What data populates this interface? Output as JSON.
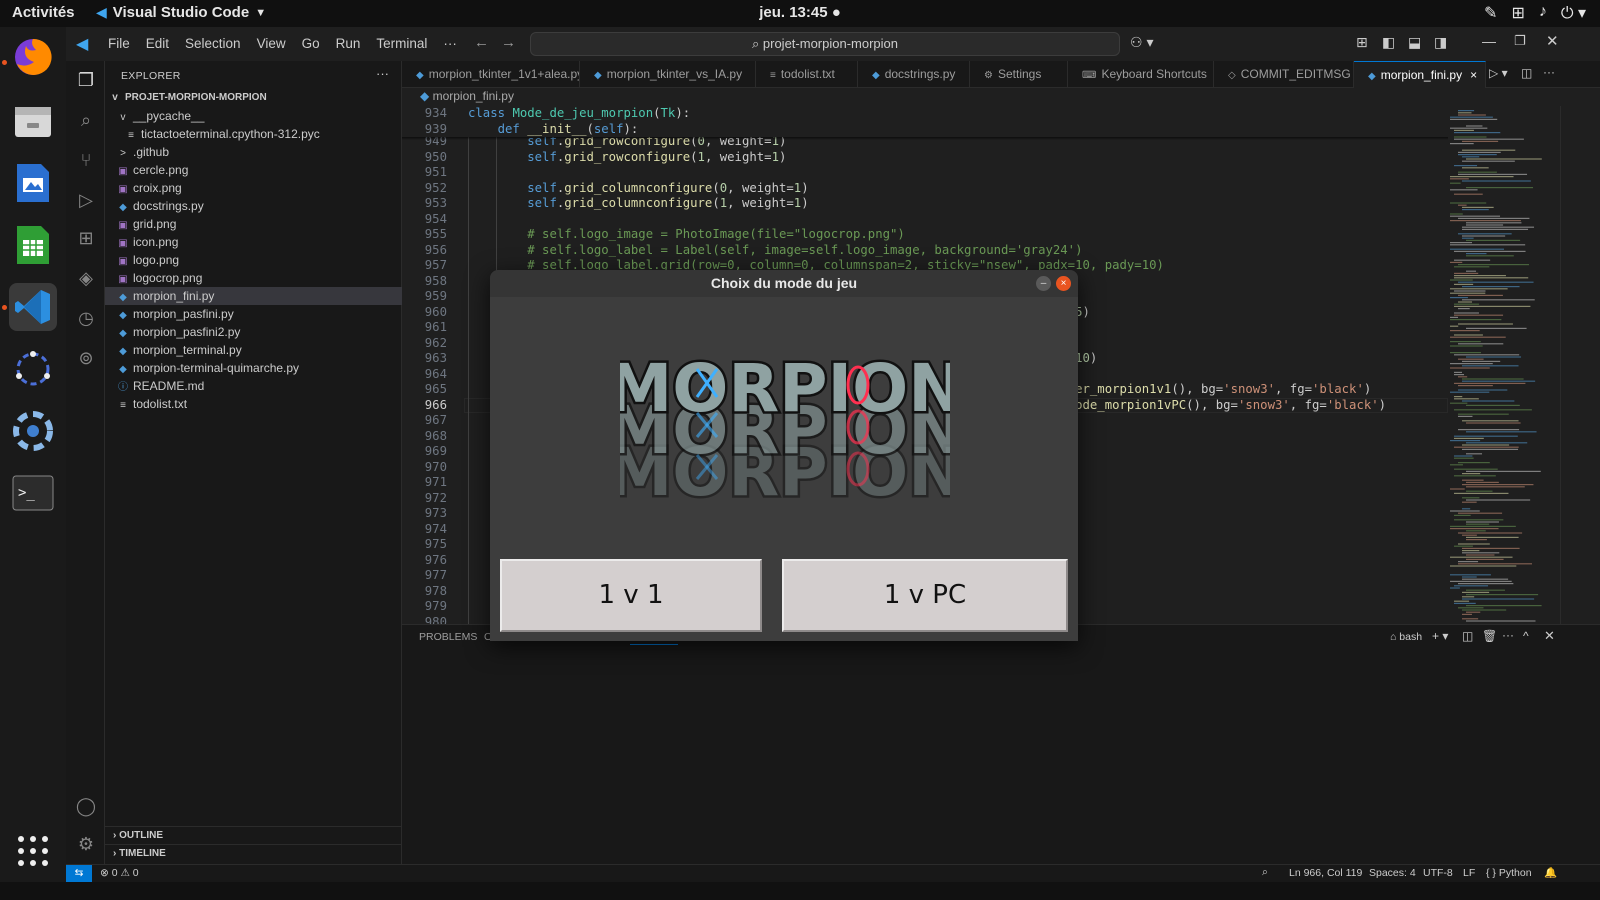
{
  "topbar": {
    "activities": "Activités",
    "app_name": "Visual Studio Code",
    "clock": "jeu. 13:45"
  },
  "dock": [
    "firefox-icon",
    "files-icon",
    "writer-icon",
    "calc-icon",
    "vscode-icon",
    "app-icon",
    "steam-icon",
    "terminal-icon",
    "show-apps-icon"
  ],
  "vscode": {
    "menu": [
      "File",
      "Edit",
      "Selection",
      "View",
      "Go",
      "Run",
      "Terminal",
      "···"
    ],
    "command_center": "projet-morpion-morpion",
    "explorer": {
      "title": "EXPLORER",
      "project": "PROJET-MORPION-MORPION",
      "items": [
        {
          "label": "__pycache__",
          "indent": 1,
          "icon": "v"
        },
        {
          "label": "tictactoeterminal.cpython-312.pyc",
          "indent": 2,
          "icon": "≡"
        },
        {
          "label": ".github",
          "indent": 1,
          "icon": ">"
        },
        {
          "label": "cercle.png",
          "indent": 1,
          "icon": "▣"
        },
        {
          "label": "croix.png",
          "indent": 1,
          "icon": "▣"
        },
        {
          "label": "docstrings.py",
          "indent": 1,
          "icon": "◆"
        },
        {
          "label": "grid.png",
          "indent": 1,
          "icon": "▣"
        },
        {
          "label": "icon.png",
          "indent": 1,
          "icon": "▣"
        },
        {
          "label": "logo.png",
          "indent": 1,
          "icon": "▣"
        },
        {
          "label": "logocrop.png",
          "indent": 1,
          "icon": "▣"
        },
        {
          "label": "morpion_fini.py",
          "indent": 1,
          "icon": "◆",
          "selected": true
        },
        {
          "label": "morpion_pasfini.py",
          "indent": 1,
          "icon": "◆"
        },
        {
          "label": "morpion_pasfini2.py",
          "indent": 1,
          "icon": "◆"
        },
        {
          "label": "morpion_terminal.py",
          "indent": 1,
          "icon": "◆"
        },
        {
          "label": "morpion-terminal-quimarche.py",
          "indent": 1,
          "icon": "◆"
        },
        {
          "label": "README.md",
          "indent": 1,
          "icon": "ⓘ"
        },
        {
          "label": "todolist.txt",
          "indent": 1,
          "icon": "≡"
        }
      ],
      "outline": "OUTLINE",
      "timeline": "TIMELINE"
    },
    "tabs": [
      {
        "label": "morpion_tkinter_1v1+alea.py",
        "icon": "◆"
      },
      {
        "label": "morpion_tkinter_vs_IA.py",
        "icon": "◆"
      },
      {
        "label": "todolist.txt",
        "icon": "≡"
      },
      {
        "label": "docstrings.py",
        "icon": "◆"
      },
      {
        "label": "Settings",
        "icon": "⚙"
      },
      {
        "label": "Keyboard Shortcuts",
        "icon": "⌨"
      },
      {
        "label": "COMMIT_EDITMSG",
        "icon": "◇"
      },
      {
        "label": "morpion_fini.py",
        "icon": "◆",
        "active": true,
        "close": "×"
      }
    ],
    "breadcrumb": "morpion_fini.py",
    "sticky": [
      {
        "n": "934",
        "html": "<span class='kw'>class</span> <span class='cls'>Mode_de_jeu_morpion</span>(<span class='cls'>Tk</span>):"
      },
      {
        "n": "939",
        "html": "    <span class='kw'>def</span> <span class='fn'>__init__</span>(<span class='self'>self</span>):"
      }
    ],
    "lines": [
      {
        "n": "949",
        "html": "        <span class='self'>self</span>.<span class='fn'>grid_rowconfigure</span>(<span class='num'>0</span>, weight=<span class='num'>1</span>)"
      },
      {
        "n": "950",
        "html": "        <span class='self'>self</span>.<span class='fn'>grid_rowconfigure</span>(<span class='num'>1</span>, weight=<span class='num'>1</span>)"
      },
      {
        "n": "951",
        "html": ""
      },
      {
        "n": "952",
        "html": "        <span class='self'>self</span>.<span class='fn'>grid_columnconfigure</span>(<span class='num'>0</span>, weight=<span class='num'>1</span>)"
      },
      {
        "n": "953",
        "html": "        <span class='self'>self</span>.<span class='fn'>grid_columnconfigure</span>(<span class='num'>1</span>, weight=<span class='num'>1</span>)"
      },
      {
        "n": "954",
        "html": ""
      },
      {
        "n": "955",
        "html": "        <span class='com'># self.logo_image = PhotoImage(file=\"logocrop.png\")</span>"
      },
      {
        "n": "956",
        "html": "        <span class='com'># self.logo_label = Label(self, image=self.logo_image, background='gray24')</span>"
      },
      {
        "n": "957",
        "html": "        <span class='com'># self.logo_label.grid(row=0, column=0, columnspan=2, sticky=\"nsew\", padx=10, pady=10)</span>"
      },
      {
        "n": "958",
        "html": ""
      },
      {
        "n": "959",
        "html": ""
      },
      {
        "n": "960",
        "html": "                                                                                  <span class='num'>5</span>)"
      },
      {
        "n": "961",
        "html": ""
      },
      {
        "n": "962",
        "html": ""
      },
      {
        "n": "963",
        "html": "                                                                                 =<span class='num'>10</span>)"
      },
      {
        "n": "964",
        "html": ""
      },
      {
        "n": "965",
        "html": "                                                                                <span class='fn'>reer_morpion1v1</span>(), bg=<span class='str'>'snow3'</span>, fg=<span class='str'>'black'</span>)"
      },
      {
        "n": "966",
        "html": "                                                                                 <span class='fn'>mode_morpion1vPC</span>(), bg=<span class='str'>'snow3'</span>, fg=<span class='str'>'black'</span>)",
        "current": true
      },
      {
        "n": "967",
        "html": ""
      },
      {
        "n": "968",
        "html": ""
      },
      {
        "n": "969",
        "html": ""
      },
      {
        "n": "970",
        "html": ""
      },
      {
        "n": "971",
        "html": ""
      },
      {
        "n": "972",
        "html": ""
      },
      {
        "n": "973",
        "html": ""
      },
      {
        "n": "974",
        "html": ""
      },
      {
        "n": "975",
        "html": ""
      },
      {
        "n": "976",
        "html": ""
      },
      {
        "n": "977",
        "html": ""
      },
      {
        "n": "978",
        "html": ""
      },
      {
        "n": "979",
        "html": ""
      },
      {
        "n": "980",
        "html": ""
      }
    ],
    "panel": {
      "problems": "PROBLEMS",
      "shell": "bash"
    },
    "status": {
      "errors": "⊗ 0 ⚠ 0",
      "position": "Ln 966, Col 119",
      "spaces": "Spaces: 4",
      "encoding": "UTF-8",
      "eol": "LF",
      "language": "{ } Python"
    }
  },
  "dialog": {
    "title": "Choix du mode du jeu",
    "logo_text": "MORPION",
    "button_1v1": "1 v 1",
    "button_1vpc": "1 v PC"
  },
  "colors": {
    "accent": "#0078d4",
    "ubuntu_orange": "#e95420",
    "tk_button": "#d4cfcf",
    "tk_bg": "#3d3d3d"
  }
}
